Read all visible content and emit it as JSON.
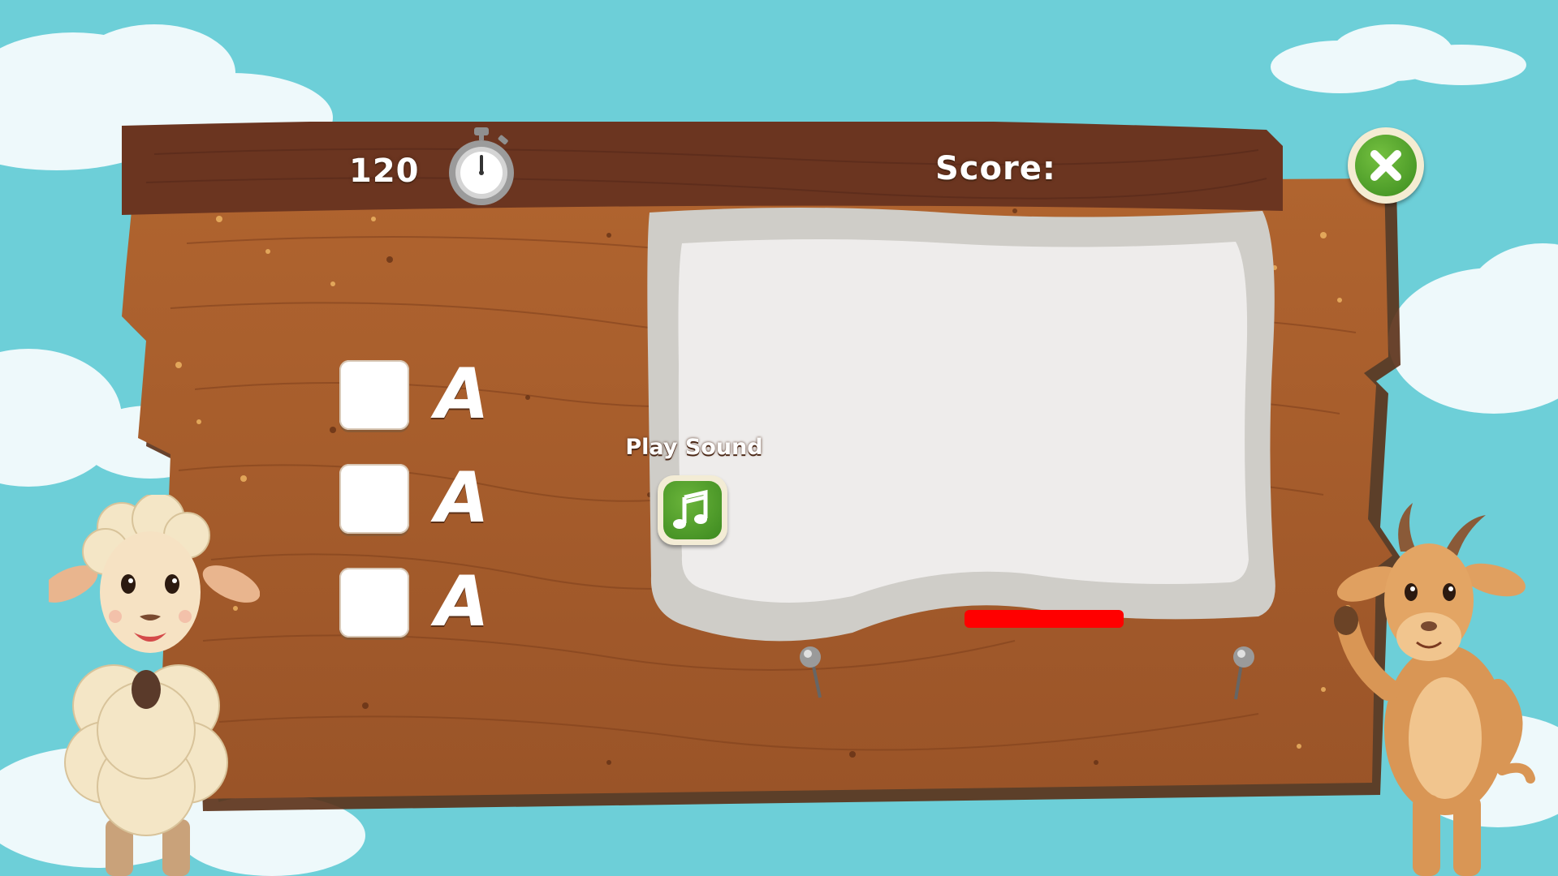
{
  "game": {
    "timer_value": "120",
    "score_label": "Score:",
    "score_value": "",
    "play_sound_label": "Play Sound",
    "options": [
      {
        "letter": "A"
      },
      {
        "letter": "A"
      },
      {
        "letter": "A"
      }
    ],
    "icons": {
      "timer": "stopwatch-icon",
      "close": "close-x-icon",
      "sound": "music-note-icon"
    },
    "colors": {
      "sky": "#6dcfd8",
      "wood": "#a35a2c",
      "topbar": "#6b3520",
      "green_button": "#3d8a20",
      "answer_bar": "#ff0000"
    }
  }
}
